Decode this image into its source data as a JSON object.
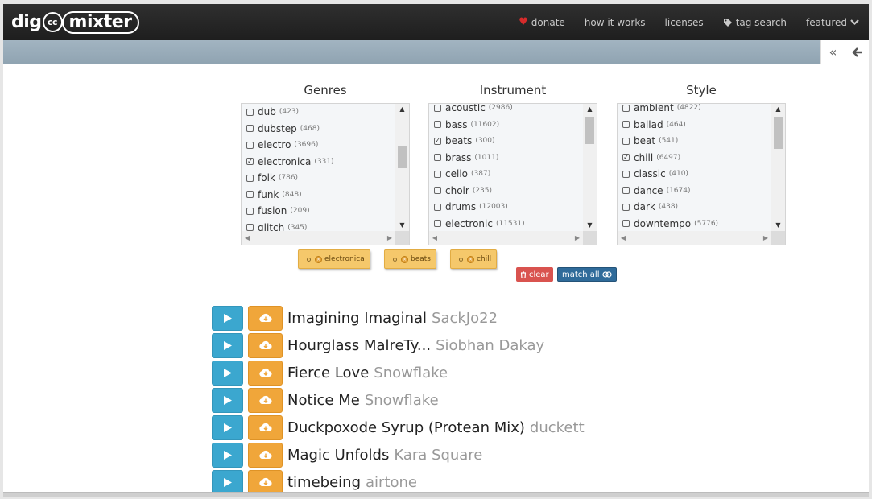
{
  "brand": {
    "dig": "dig",
    "cc": "cc",
    "mixter": "mixter"
  },
  "nav": {
    "donate": "donate",
    "how_it_works": "how it works",
    "licenses": "licenses",
    "tag_search": "tag search",
    "featured": "featured"
  },
  "icons": {
    "heart": "heart-icon",
    "tag": "tag-icon",
    "chevron": "chevron-down-icon",
    "collapse": "double-chevron-left-icon",
    "back": "arrow-left-icon",
    "play": "play-icon",
    "download": "cloud-download-icon",
    "trash": "trash-icon",
    "link": "link-icon"
  },
  "filters": {
    "genres": {
      "title": "Genres",
      "items": [
        {
          "label": "dub",
          "count": "(423)",
          "checked": false
        },
        {
          "label": "dubstep",
          "count": "(468)",
          "checked": false
        },
        {
          "label": "electro",
          "count": "(3696)",
          "checked": false
        },
        {
          "label": "electronica",
          "count": "(331)",
          "checked": true
        },
        {
          "label": "folk",
          "count": "(786)",
          "checked": false
        },
        {
          "label": "funk",
          "count": "(848)",
          "checked": false
        },
        {
          "label": "fusion",
          "count": "(209)",
          "checked": false
        },
        {
          "label": "glitch",
          "count": "(345)",
          "checked": false
        }
      ]
    },
    "instrument": {
      "title": "Instrument",
      "items": [
        {
          "label": "acoustic",
          "count": "(2986)",
          "checked": false
        },
        {
          "label": "bass",
          "count": "(11602)",
          "checked": false
        },
        {
          "label": "beats",
          "count": "(300)",
          "checked": true
        },
        {
          "label": "brass",
          "count": "(1011)",
          "checked": false
        },
        {
          "label": "cello",
          "count": "(387)",
          "checked": false
        },
        {
          "label": "choir",
          "count": "(235)",
          "checked": false
        },
        {
          "label": "drums",
          "count": "(12003)",
          "checked": false
        },
        {
          "label": "electronic",
          "count": "(11531)",
          "checked": false
        }
      ]
    },
    "style": {
      "title": "Style",
      "items": [
        {
          "label": "ambient",
          "count": "(4822)",
          "checked": false
        },
        {
          "label": "ballad",
          "count": "(464)",
          "checked": false
        },
        {
          "label": "beat",
          "count": "(541)",
          "checked": false
        },
        {
          "label": "chill",
          "count": "(6497)",
          "checked": true
        },
        {
          "label": "classic",
          "count": "(410)",
          "checked": false
        },
        {
          "label": "dance",
          "count": "(1674)",
          "checked": false
        },
        {
          "label": "dark",
          "count": "(438)",
          "checked": false
        },
        {
          "label": "downtempo",
          "count": "(5776)",
          "checked": false
        }
      ]
    }
  },
  "selected_tags": [
    "electronica",
    "beats",
    "chill"
  ],
  "actions": {
    "clear": "clear",
    "match_all": "match all"
  },
  "tracks": [
    {
      "title": "Imagining Imaginal",
      "artist": "SackJo22"
    },
    {
      "title": "Hourglass MalreTy...",
      "artist": "Siobhan Dakay"
    },
    {
      "title": "Fierce Love",
      "artist": "Snowflake"
    },
    {
      "title": "Notice Me",
      "artist": "Snowflake"
    },
    {
      "title": "Duckpoxode Syrup (Protean Mix)",
      "artist": "duckett"
    },
    {
      "title": "Magic Unfolds",
      "artist": "Kara Square"
    },
    {
      "title": "timebeing",
      "artist": "airtone"
    }
  ],
  "colors": {
    "play": "#3ba7cf",
    "download": "#f0a63a",
    "clear": "#d9534f",
    "match": "#2f6b9a",
    "tag": "#f5c86b"
  }
}
